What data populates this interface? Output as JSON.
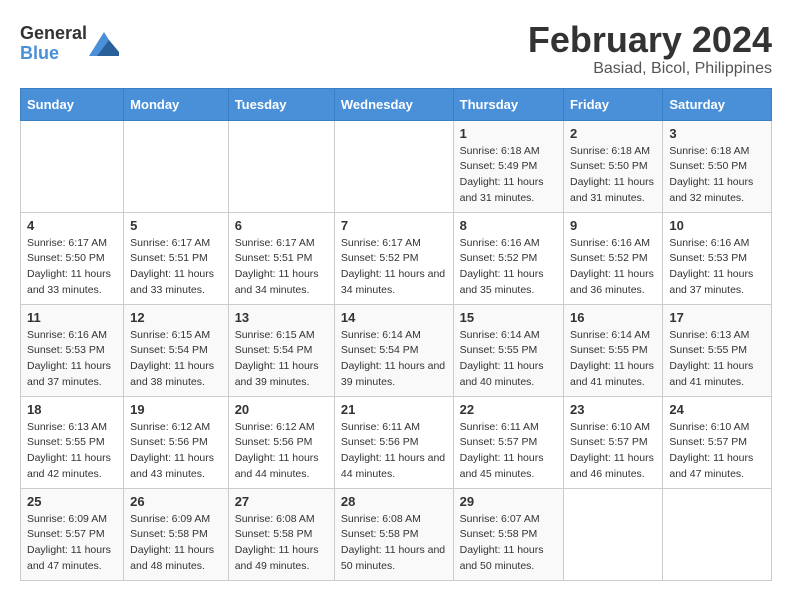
{
  "logo": {
    "text_general": "General",
    "text_blue": "Blue"
  },
  "header": {
    "title": "February 2024",
    "subtitle": "Basiad, Bicol, Philippines"
  },
  "days_of_week": [
    "Sunday",
    "Monday",
    "Tuesday",
    "Wednesday",
    "Thursday",
    "Friday",
    "Saturday"
  ],
  "weeks": [
    [
      {
        "day": "",
        "sunrise": "",
        "sunset": "",
        "daylight": ""
      },
      {
        "day": "",
        "sunrise": "",
        "sunset": "",
        "daylight": ""
      },
      {
        "day": "",
        "sunrise": "",
        "sunset": "",
        "daylight": ""
      },
      {
        "day": "",
        "sunrise": "",
        "sunset": "",
        "daylight": ""
      },
      {
        "day": "1",
        "sunrise": "6:18 AM",
        "sunset": "5:49 PM",
        "daylight": "11 hours and 31 minutes."
      },
      {
        "day": "2",
        "sunrise": "6:18 AM",
        "sunset": "5:50 PM",
        "daylight": "11 hours and 31 minutes."
      },
      {
        "day": "3",
        "sunrise": "6:18 AM",
        "sunset": "5:50 PM",
        "daylight": "11 hours and 32 minutes."
      }
    ],
    [
      {
        "day": "4",
        "sunrise": "6:17 AM",
        "sunset": "5:50 PM",
        "daylight": "11 hours and 33 minutes."
      },
      {
        "day": "5",
        "sunrise": "6:17 AM",
        "sunset": "5:51 PM",
        "daylight": "11 hours and 33 minutes."
      },
      {
        "day": "6",
        "sunrise": "6:17 AM",
        "sunset": "5:51 PM",
        "daylight": "11 hours and 34 minutes."
      },
      {
        "day": "7",
        "sunrise": "6:17 AM",
        "sunset": "5:52 PM",
        "daylight": "11 hours and 34 minutes."
      },
      {
        "day": "8",
        "sunrise": "6:16 AM",
        "sunset": "5:52 PM",
        "daylight": "11 hours and 35 minutes."
      },
      {
        "day": "9",
        "sunrise": "6:16 AM",
        "sunset": "5:52 PM",
        "daylight": "11 hours and 36 minutes."
      },
      {
        "day": "10",
        "sunrise": "6:16 AM",
        "sunset": "5:53 PM",
        "daylight": "11 hours and 37 minutes."
      }
    ],
    [
      {
        "day": "11",
        "sunrise": "6:16 AM",
        "sunset": "5:53 PM",
        "daylight": "11 hours and 37 minutes."
      },
      {
        "day": "12",
        "sunrise": "6:15 AM",
        "sunset": "5:54 PM",
        "daylight": "11 hours and 38 minutes."
      },
      {
        "day": "13",
        "sunrise": "6:15 AM",
        "sunset": "5:54 PM",
        "daylight": "11 hours and 39 minutes."
      },
      {
        "day": "14",
        "sunrise": "6:14 AM",
        "sunset": "5:54 PM",
        "daylight": "11 hours and 39 minutes."
      },
      {
        "day": "15",
        "sunrise": "6:14 AM",
        "sunset": "5:55 PM",
        "daylight": "11 hours and 40 minutes."
      },
      {
        "day": "16",
        "sunrise": "6:14 AM",
        "sunset": "5:55 PM",
        "daylight": "11 hours and 41 minutes."
      },
      {
        "day": "17",
        "sunrise": "6:13 AM",
        "sunset": "5:55 PM",
        "daylight": "11 hours and 41 minutes."
      }
    ],
    [
      {
        "day": "18",
        "sunrise": "6:13 AM",
        "sunset": "5:55 PM",
        "daylight": "11 hours and 42 minutes."
      },
      {
        "day": "19",
        "sunrise": "6:12 AM",
        "sunset": "5:56 PM",
        "daylight": "11 hours and 43 minutes."
      },
      {
        "day": "20",
        "sunrise": "6:12 AM",
        "sunset": "5:56 PM",
        "daylight": "11 hours and 44 minutes."
      },
      {
        "day": "21",
        "sunrise": "6:11 AM",
        "sunset": "5:56 PM",
        "daylight": "11 hours and 44 minutes."
      },
      {
        "day": "22",
        "sunrise": "6:11 AM",
        "sunset": "5:57 PM",
        "daylight": "11 hours and 45 minutes."
      },
      {
        "day": "23",
        "sunrise": "6:10 AM",
        "sunset": "5:57 PM",
        "daylight": "11 hours and 46 minutes."
      },
      {
        "day": "24",
        "sunrise": "6:10 AM",
        "sunset": "5:57 PM",
        "daylight": "11 hours and 47 minutes."
      }
    ],
    [
      {
        "day": "25",
        "sunrise": "6:09 AM",
        "sunset": "5:57 PM",
        "daylight": "11 hours and 47 minutes."
      },
      {
        "day": "26",
        "sunrise": "6:09 AM",
        "sunset": "5:58 PM",
        "daylight": "11 hours and 48 minutes."
      },
      {
        "day": "27",
        "sunrise": "6:08 AM",
        "sunset": "5:58 PM",
        "daylight": "11 hours and 49 minutes."
      },
      {
        "day": "28",
        "sunrise": "6:08 AM",
        "sunset": "5:58 PM",
        "daylight": "11 hours and 50 minutes."
      },
      {
        "day": "29",
        "sunrise": "6:07 AM",
        "sunset": "5:58 PM",
        "daylight": "11 hours and 50 minutes."
      },
      {
        "day": "",
        "sunrise": "",
        "sunset": "",
        "daylight": ""
      },
      {
        "day": "",
        "sunrise": "",
        "sunset": "",
        "daylight": ""
      }
    ]
  ],
  "labels": {
    "sunrise": "Sunrise:",
    "sunset": "Sunset:",
    "daylight": "Daylight:"
  }
}
